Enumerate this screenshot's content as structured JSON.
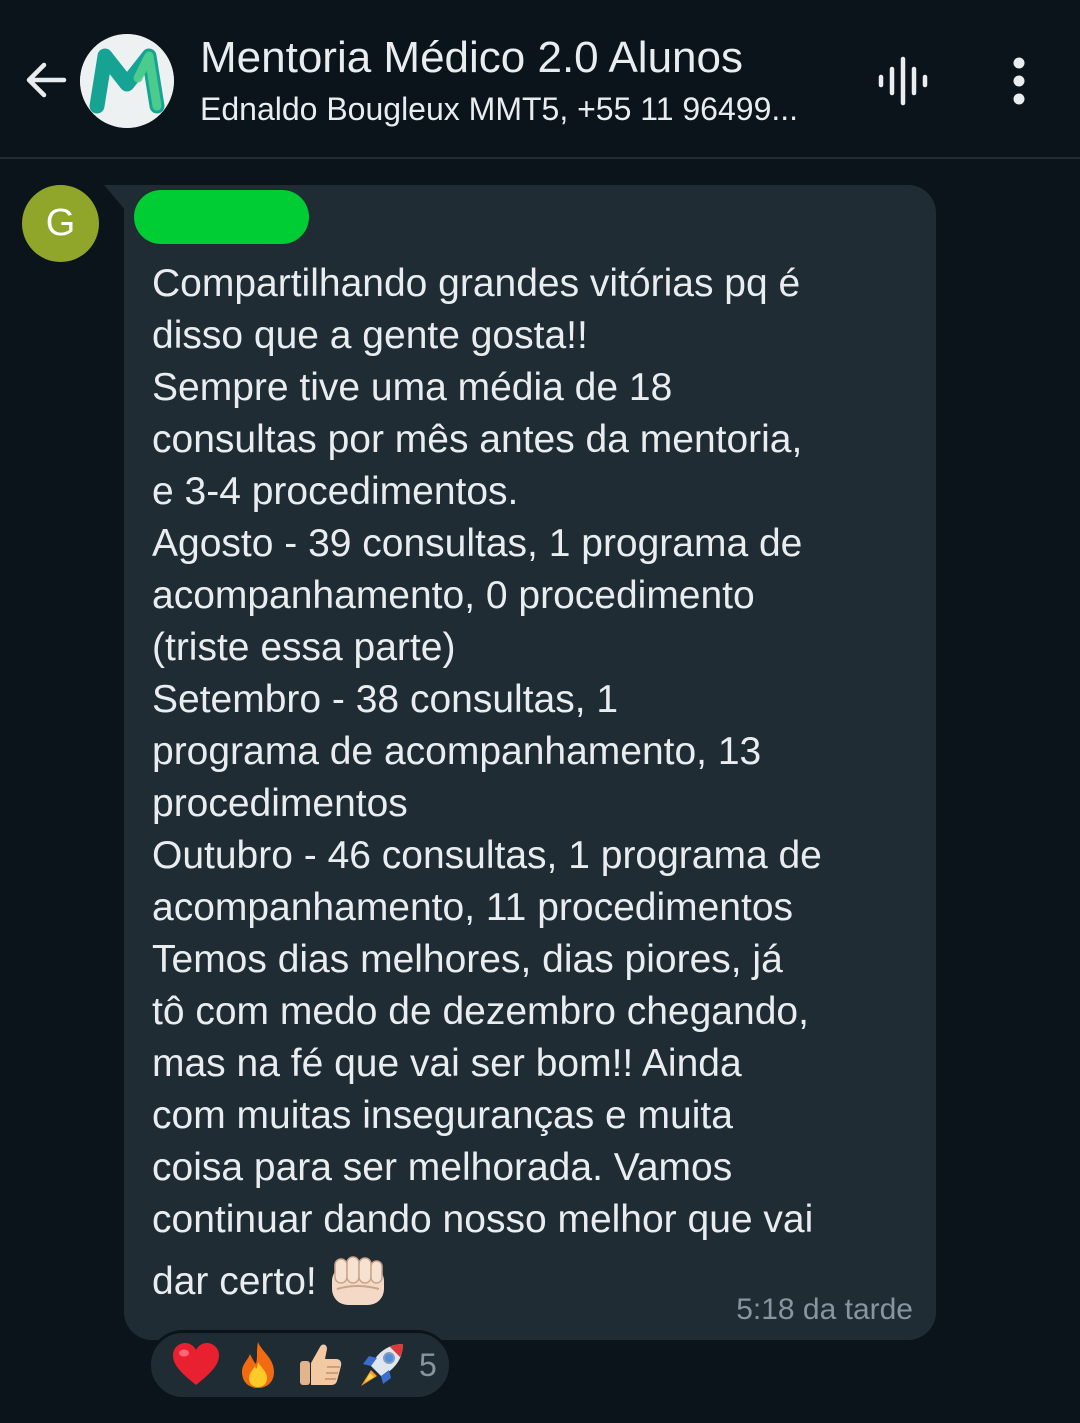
{
  "header": {
    "title": "Mentoria Médico 2.0 Alunos",
    "members": "Ednaldo Bougleux MMT5, +55 11 96499...",
    "avatar_logo": "M"
  },
  "message": {
    "sender_initial": "G",
    "text": "Compartilhando grandes vitórias pq é\ndisso que a gente gosta!!\nSempre tive uma média de 18\nconsultas por mês antes da mentoria,\ne 3-4 procedimentos.\nAgosto - 39 consultas, 1 programa de\nacompanhamento, 0 procedimento\n(triste essa parte)\nSetembro - 38 consultas, 1\nprograma de acompanhamento, 13\nprocedimentos\nOutubro - 46 consultas, 1 programa de\nacompanhamento, 11 procedimentos\nTemos dias melhores, dias piores, já\ntô com medo de dezembro chegando,\nmas na fé que vai ser bom!! Ainda\ncom muitas inseguranças e muita\ncoisa para ser melhorada. Vamos\ncontinuar dando nosso melhor que vai",
    "last_line": "dar certo!",
    "timestamp": "5:18 da tarde"
  },
  "reactions": {
    "emojis": [
      "heart",
      "fire",
      "thumbs-up",
      "rocket"
    ],
    "count": "5"
  },
  "colors": {
    "background": "#0b141a",
    "bubble": "#1f2c34",
    "text": "#e9edef",
    "muted": "#8696a0",
    "redaction": "#00cc33",
    "sender_avatar": "#8fa62b"
  }
}
